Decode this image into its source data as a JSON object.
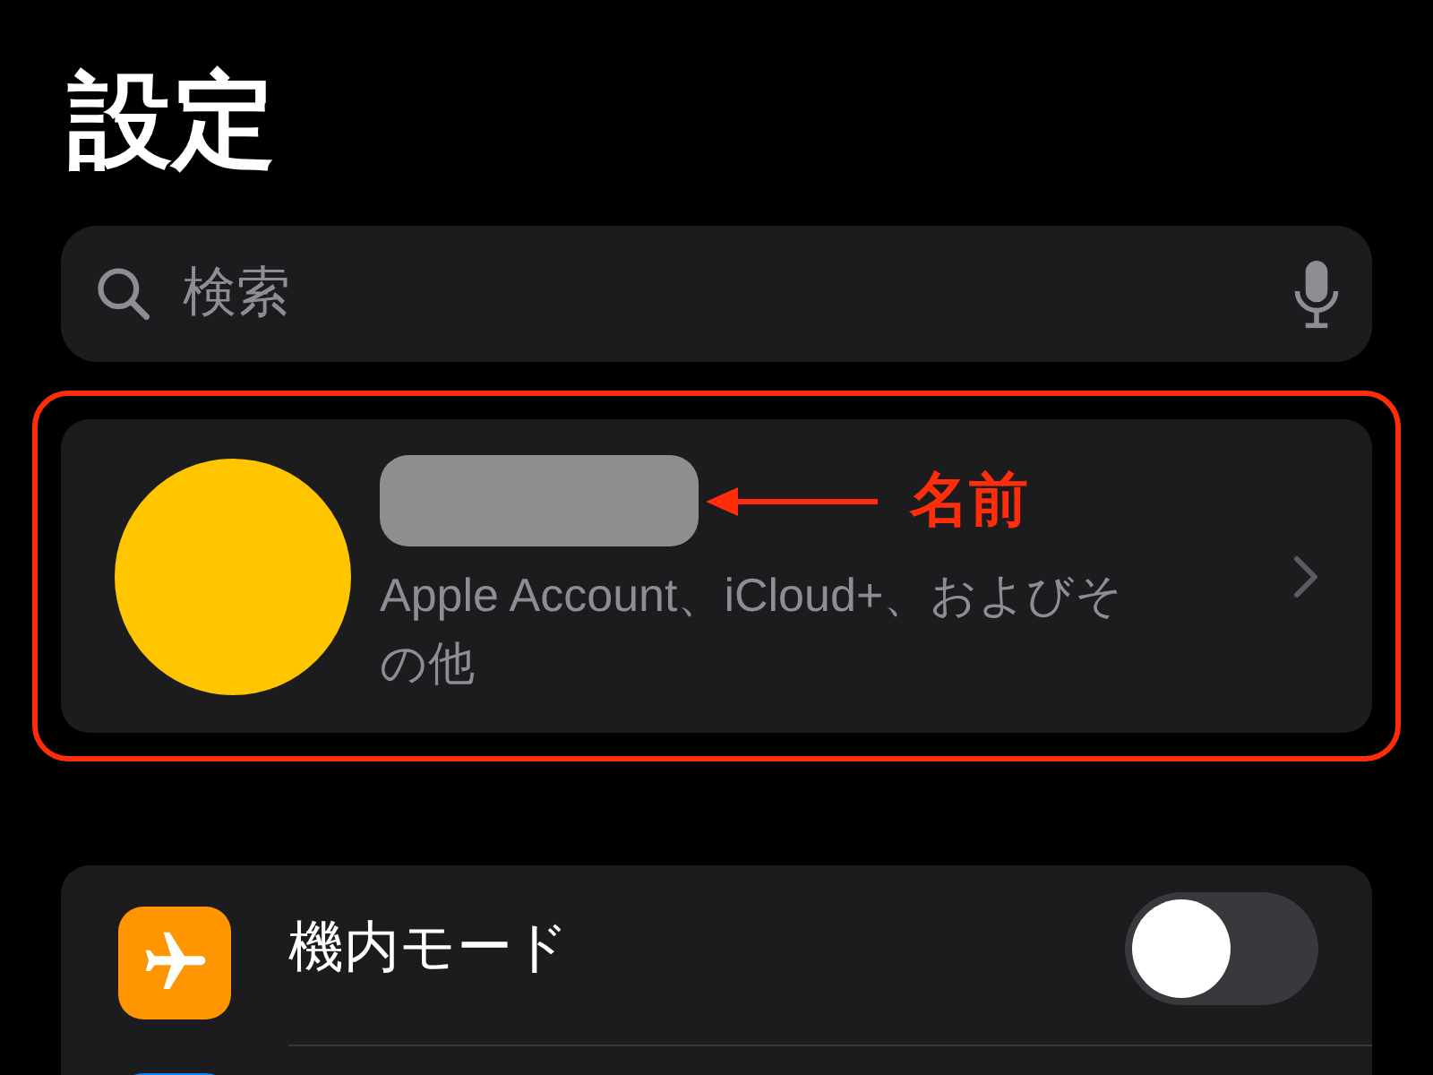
{
  "title": "設定",
  "search": {
    "placeholder": "検索"
  },
  "account": {
    "subtitle": "Apple Account、iCloud+、およびその他",
    "annotation": "名前"
  },
  "rows": [
    {
      "kind": "toggle",
      "label": "機内モード",
      "color": "#ff9500",
      "on": false
    },
    {
      "kind": "link",
      "color": "#0a84ff"
    }
  ]
}
